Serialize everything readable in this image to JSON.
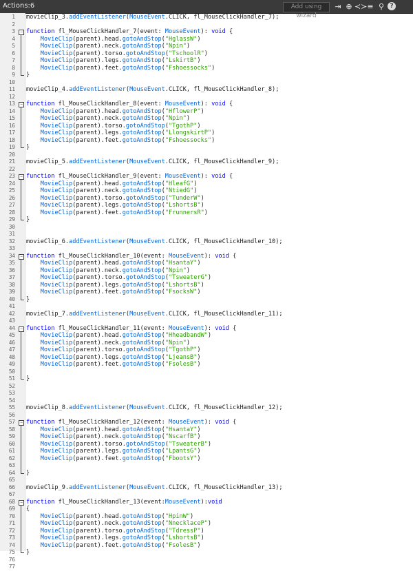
{
  "toolbar": {
    "title": "Actions:6",
    "wizard_label": "Add using wizard",
    "icons": [
      "insert-target-icon",
      "target-icon",
      "code-snippets-icon",
      "format-icon",
      "find-icon",
      "help-icon"
    ],
    "help_glyph": "?"
  },
  "colors": {
    "keyword": "#0000ff",
    "type": "#0066dd",
    "string": "#2da100",
    "text": "#1a1a1a"
  },
  "lines": [
    {
      "n": "1",
      "t": "movieClip_3.addEventListener(MouseEvent.CLICK, fl_MouseClickHandler_7);"
    },
    {
      "n": "2",
      "t": ""
    },
    {
      "n": "3",
      "t": "function fl_MouseClickHandler_7(event: MouseEvent): void {"
    },
    {
      "n": "4",
      "t": "    MovieClip(parent).head.gotoAndStop(\"HglassW\")"
    },
    {
      "n": "5",
      "t": "    MovieClip(parent).neck.gotoAndStop(\"Npin\")"
    },
    {
      "n": "6",
      "t": "    MovieClip(parent).torso.gotoAndStop(\"TschoolR\")"
    },
    {
      "n": "7",
      "t": "    MovieClip(parent).legs.gotoAndStop(\"LskirtB\")"
    },
    {
      "n": "8",
      "t": "    MovieClip(parent).feet.gotoAndStop(\"Fshoessocks\")"
    },
    {
      "n": "9",
      "t": "}"
    },
    {
      "n": "10",
      "t": ""
    },
    {
      "n": "11",
      "t": "movieClip_4.addEventListener(MouseEvent.CLICK, fl_MouseClickHandler_8);"
    },
    {
      "n": "12",
      "t": ""
    },
    {
      "n": "13",
      "t": "function fl_MouseClickHandler_8(event: MouseEvent): void {"
    },
    {
      "n": "14",
      "t": "    MovieClip(parent).head.gotoAndStop(\"HflowerP\")"
    },
    {
      "n": "15",
      "t": "    MovieClip(parent).neck.gotoAndStop(\"Npin\")"
    },
    {
      "n": "16",
      "t": "    MovieClip(parent).torso.gotoAndStop(\"TgothP\")"
    },
    {
      "n": "17",
      "t": "    MovieClip(parent).legs.gotoAndStop(\"LlongskirtP\")"
    },
    {
      "n": "18",
      "t": "    MovieClip(parent).feet.gotoAndStop(\"Fshoessocks\")"
    },
    {
      "n": "19",
      "t": "}"
    },
    {
      "n": "20",
      "t": ""
    },
    {
      "n": "21",
      "t": "movieClip_5.addEventListener(MouseEvent.CLICK, fl_MouseClickHandler_9);"
    },
    {
      "n": "22",
      "t": ""
    },
    {
      "n": "23",
      "t": "function fl_MouseClickHandler_9(event: MouseEvent): void {"
    },
    {
      "n": "24",
      "t": "    MovieClip(parent).head.gotoAndStop(\"HleafG\")"
    },
    {
      "n": "25",
      "t": "    MovieClip(parent).neck.gotoAndStop(\"NtiedG\")"
    },
    {
      "n": "26",
      "t": "    MovieClip(parent).torso.gotoAndStop(\"TunderW\")"
    },
    {
      "n": "27",
      "t": "    MovieClip(parent).legs.gotoAndStop(\"LshortsB\")"
    },
    {
      "n": "28",
      "t": "    MovieClip(parent).feet.gotoAndStop(\"FrunnersR\")"
    },
    {
      "n": "29",
      "t": "}"
    },
    {
      "n": "30",
      "t": ""
    },
    {
      "n": "31",
      "t": ""
    },
    {
      "n": "32",
      "t": "movieClip_6.addEventListener(MouseEvent.CLICK, fl_MouseClickHandler_10);"
    },
    {
      "n": "33",
      "t": ""
    },
    {
      "n": "34",
      "t": "function fl_MouseClickHandler_10(event: MouseEvent): void {"
    },
    {
      "n": "35",
      "t": "    MovieClip(parent).head.gotoAndStop(\"HsantaY\")"
    },
    {
      "n": "36",
      "t": "    MovieClip(parent).neck.gotoAndStop(\"Npin\")"
    },
    {
      "n": "37",
      "t": "    MovieClip(parent).torso.gotoAndStop(\"TsweaterG\")"
    },
    {
      "n": "38",
      "t": "    MovieClip(parent).legs.gotoAndStop(\"LshortsB\")"
    },
    {
      "n": "39",
      "t": "    MovieClip(parent).feet.gotoAndStop(\"FsocksW\")"
    },
    {
      "n": "40",
      "t": "}"
    },
    {
      "n": "41",
      "t": ""
    },
    {
      "n": "42",
      "t": "movieClip_7.addEventListener(MouseEvent.CLICK, fl_MouseClickHandler_11);"
    },
    {
      "n": "43",
      "t": ""
    },
    {
      "n": "44",
      "t": "function fl_MouseClickHandler_11(event: MouseEvent): void {"
    },
    {
      "n": "45",
      "t": "    MovieClip(parent).head.gotoAndStop(\"HheadbandW\")"
    },
    {
      "n": "46",
      "t": "    MovieClip(parent).neck.gotoAndStop(\"Npin\")"
    },
    {
      "n": "47",
      "t": "    MovieClip(parent).torso.gotoAndStop(\"TgothP\")"
    },
    {
      "n": "48",
      "t": "    MovieClip(parent).legs.gotoAndStop(\"LjeansB\")"
    },
    {
      "n": "49",
      "t": "    MovieClip(parent).feet.gotoAndStop(\"FsolesB\")"
    },
    {
      "n": "50",
      "t": ""
    },
    {
      "n": "51",
      "t": "}"
    },
    {
      "n": "52",
      "t": ""
    },
    {
      "n": "53",
      "t": ""
    },
    {
      "n": "54",
      "t": ""
    },
    {
      "n": "55",
      "t": "movieClip_8.addEventListener(MouseEvent.CLICK, fl_MouseClickHandler_12);"
    },
    {
      "n": "56",
      "t": ""
    },
    {
      "n": "57",
      "t": "function fl_MouseClickHandler_12(event: MouseEvent): void {"
    },
    {
      "n": "58",
      "t": "    MovieClip(parent).head.gotoAndStop(\"HsantaY\")"
    },
    {
      "n": "59",
      "t": "    MovieClip(parent).neck.gotoAndStop(\"NscarfB\")"
    },
    {
      "n": "60",
      "t": "    MovieClip(parent).torso.gotoAndStop(\"TsweaterB\")"
    },
    {
      "n": "61",
      "t": "    MovieClip(parent).legs.gotoAndStop(\"LpantsG\")"
    },
    {
      "n": "62",
      "t": "    MovieClip(parent).feet.gotoAndStop(\"FbootsY\")"
    },
    {
      "n": "63",
      "t": ""
    },
    {
      "n": "64",
      "t": "}"
    },
    {
      "n": "65",
      "t": ""
    },
    {
      "n": "66",
      "t": "movieClip_9.addEventListener(MouseEvent.CLICK, fl_MouseClickHandler_13);"
    },
    {
      "n": "67",
      "t": ""
    },
    {
      "n": "68",
      "t": "function fl_MouseClickHandler_13(event:MouseEvent):void"
    },
    {
      "n": "69",
      "t": "{"
    },
    {
      "n": "70",
      "t": "    MovieClip(parent).head.gotoAndStop(\"HpinW\")"
    },
    {
      "n": "71",
      "t": "    MovieClip(parent).neck.gotoAndStop(\"NnecklaceP\")"
    },
    {
      "n": "72",
      "t": "    MovieClip(parent).torso.gotoAndStop(\"TdressP\")"
    },
    {
      "n": "73",
      "t": "    MovieClip(parent).legs.gotoAndStop(\"LshortsB\")"
    },
    {
      "n": "74",
      "t": "    MovieClip(parent).feet.gotoAndStop(\"FsolesB\")"
    },
    {
      "n": "75",
      "t": "}"
    },
    {
      "n": "76",
      "t": ""
    },
    {
      "n": "77",
      "t": ""
    }
  ]
}
